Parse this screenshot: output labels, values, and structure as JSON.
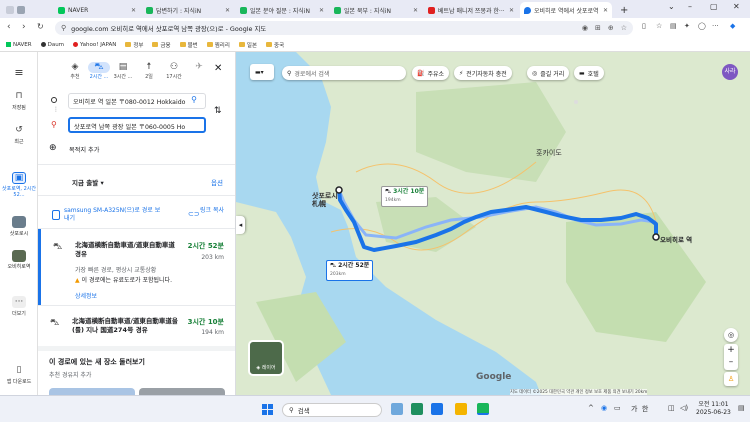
{
  "browser": {
    "tabs": [
      {
        "title": "NAVER",
        "color": "#03c75a"
      },
      {
        "title": "답변하기 : 지식iN",
        "color": "#19b65a"
      },
      {
        "title": "일본 분야 질문 : 지식iN",
        "color": "#19b65a"
      },
      {
        "title": "일본 북부 : 지식iN",
        "color": "#19b65a"
      },
      {
        "title": "베트남 매니저 쯔몽과 한···",
        "color": "#e02020"
      },
      {
        "title": "오비히로 역에서 삿포로역",
        "color": "#1a73e8",
        "active": true
      }
    ],
    "new_tab": "+",
    "url": "google.com 오비히로 역에서 삿포로역 남쪽 광장(으)로 - Google 지도",
    "bookmarks": [
      "NAVER",
      "Daum",
      "Yahoo! JAPAN",
      "정부",
      "금융",
      "블번",
      "찜리리",
      "일본",
      "중국"
    ]
  },
  "rail": {
    "menu": "≡",
    "items": [
      {
        "label": "저장됨",
        "icon": "bookmark-icon"
      },
      {
        "label": "최근",
        "icon": "history-icon"
      },
      {
        "label": "삿포로역, 2시간 52...",
        "icon": "car-icon"
      },
      {
        "label": "삿포로시",
        "icon": "thumb-sapporo-icon"
      },
      {
        "label": "오비히로역",
        "icon": "thumb-obihiro-icon"
      },
      {
        "label": "더보기",
        "icon": "more-icon"
      }
    ],
    "download": "앱 다운로드"
  },
  "panel": {
    "modes": [
      {
        "label": "추천",
        "icon": "◈"
      },
      {
        "label": "2시간 ...",
        "icon": "car"
      },
      {
        "label": "3시간 ...",
        "icon": "bus"
      },
      {
        "label": "2일",
        "icon": "walk"
      },
      {
        "label": "17시간",
        "icon": "bike"
      },
      {
        "label": "",
        "icon": "plane"
      }
    ],
    "origin": "오비히로 역 일본 〒080-0012 Hokkaido",
    "destination": "삿포로역 남쪽 광장 일본 〒060-0005 Ho",
    "add_destination": "목적지 추가",
    "depart_now": "지금 출발",
    "options": "옵션",
    "send_to_phone": "samsung SM-A325N(으)로 경로 보내기",
    "copy_link": "링크 복사",
    "routes": [
      {
        "title": "北海道横断自動車道/道東自動車道 경유",
        "time": "2시간 52분",
        "dist": "203 km",
        "sub": "가장 빠른 경로, 평상시 교통상황",
        "warn": "이 경로에는 유료도로가 포함됩니다.",
        "detail": "상세정보"
      },
      {
        "title": "北海道横断自動車道/道東自動車道을(를) 지나 国道274号 경유",
        "time": "3시간 10분",
        "dist": "194 km"
      }
    ],
    "explore_title": "이 경로에 있는 새 장소 둘러보기",
    "explore_sub": "추천 경유지 추가"
  },
  "map": {
    "search_placeholder": "경로에서 검색",
    "chips": [
      "주유소",
      "전기자동차 충전",
      "즐길 거리",
      "호텔"
    ],
    "labels": {
      "sapporo": "삿포로시\n札幌",
      "obihiro": "오비히로 역",
      "hokkaido": "훗카이도",
      "t1": "2시간 52분",
      "t1b": "203km",
      "t2": "3시간 10분",
      "t2b": "194km",
      "layer": "레이어",
      "google": "Google",
      "footer": "지도 데이터 ©2025  대한민국  약관  개인 정보 보호  제품 의견 보내기  20km"
    },
    "accent": "#1a73e8"
  },
  "taskbar": {
    "search": "검색",
    "time": "오전 11:01",
    "date": "2025-06-23",
    "lang": "가  한"
  }
}
